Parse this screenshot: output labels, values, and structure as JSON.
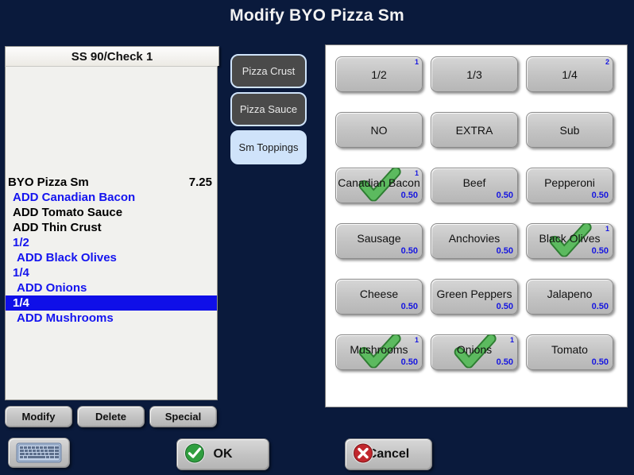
{
  "window": {
    "title": "Modify BYO Pizza Sm"
  },
  "check": {
    "header": "SS 90/Check 1",
    "rows": [
      {
        "text": "BYO Pizza Sm",
        "price": "7.25",
        "color": "black",
        "indent": 0,
        "selected": false
      },
      {
        "text": "ADD Canadian Bacon",
        "price": "",
        "color": "blue",
        "indent": 1,
        "selected": false
      },
      {
        "text": "ADD Tomato Sauce",
        "price": "",
        "color": "black",
        "indent": 1,
        "selected": false
      },
      {
        "text": "ADD Thin Crust",
        "price": "",
        "color": "black",
        "indent": 1,
        "selected": false
      },
      {
        "text": "1/2",
        "price": "",
        "color": "blue",
        "indent": 1,
        "selected": false
      },
      {
        "text": "ADD Black Olives",
        "price": "",
        "color": "blue",
        "indent": 2,
        "selected": false
      },
      {
        "text": "1/4",
        "price": "",
        "color": "blue",
        "indent": 1,
        "selected": false
      },
      {
        "text": "ADD Onions",
        "price": "",
        "color": "blue",
        "indent": 2,
        "selected": false
      },
      {
        "text": "1/4",
        "price": "",
        "color": "blue",
        "indent": 1,
        "selected": true
      },
      {
        "text": "ADD Mushrooms",
        "price": "",
        "color": "blue",
        "indent": 2,
        "selected": false
      }
    ]
  },
  "actions": {
    "modify": "Modify",
    "delete": "Delete",
    "special": "Special"
  },
  "categories": [
    {
      "label": "Pizza Crust",
      "selected": false
    },
    {
      "label": "Pizza Sauce",
      "selected": false
    },
    {
      "label": "Sm Toppings",
      "selected": true
    }
  ],
  "modifiers": [
    {
      "label": "1/2",
      "qty": "1",
      "price": "",
      "checked": false
    },
    {
      "label": "1/3",
      "qty": "",
      "price": "",
      "checked": false
    },
    {
      "label": "1/4",
      "qty": "2",
      "price": "",
      "checked": false
    },
    {
      "label": "NO",
      "qty": "",
      "price": "",
      "checked": false
    },
    {
      "label": "EXTRA",
      "qty": "",
      "price": "",
      "checked": false
    },
    {
      "label": "Sub",
      "qty": "",
      "price": "",
      "checked": false
    },
    {
      "label": "Canadian Bacon",
      "qty": "1",
      "price": "0.50",
      "checked": true
    },
    {
      "label": "Beef",
      "qty": "",
      "price": "0.50",
      "checked": false
    },
    {
      "label": "Pepperoni",
      "qty": "",
      "price": "0.50",
      "checked": false
    },
    {
      "label": "Sausage",
      "qty": "",
      "price": "0.50",
      "checked": false
    },
    {
      "label": "Anchovies",
      "qty": "",
      "price": "0.50",
      "checked": false
    },
    {
      "label": "Black Olives",
      "qty": "1",
      "price": "0.50",
      "checked": true
    },
    {
      "label": "Cheese",
      "qty": "",
      "price": "0.50",
      "checked": false
    },
    {
      "label": "Green Peppers",
      "qty": "",
      "price": "0.50",
      "checked": false
    },
    {
      "label": "Jalapeno",
      "qty": "",
      "price": "0.50",
      "checked": false
    },
    {
      "label": "Mushrooms",
      "qty": "1",
      "price": "0.50",
      "checked": true
    },
    {
      "label": "Onions",
      "qty": "1",
      "price": "0.50",
      "checked": true
    },
    {
      "label": "Tomato",
      "qty": "",
      "price": "0.50",
      "checked": false
    }
  ],
  "footer": {
    "keyboard_icon": "keyboard-icon",
    "ok": "OK",
    "cancel": "Cancel"
  },
  "colors": {
    "background": "#0a1a3c",
    "accent_blue": "#1414ef",
    "selection": "#0f0fe8",
    "check_green": "#3fa64a",
    "cancel_red": "#c1272d",
    "tab_active": "#cfe3fa",
    "tab_inactive": "#4a4a4a"
  }
}
